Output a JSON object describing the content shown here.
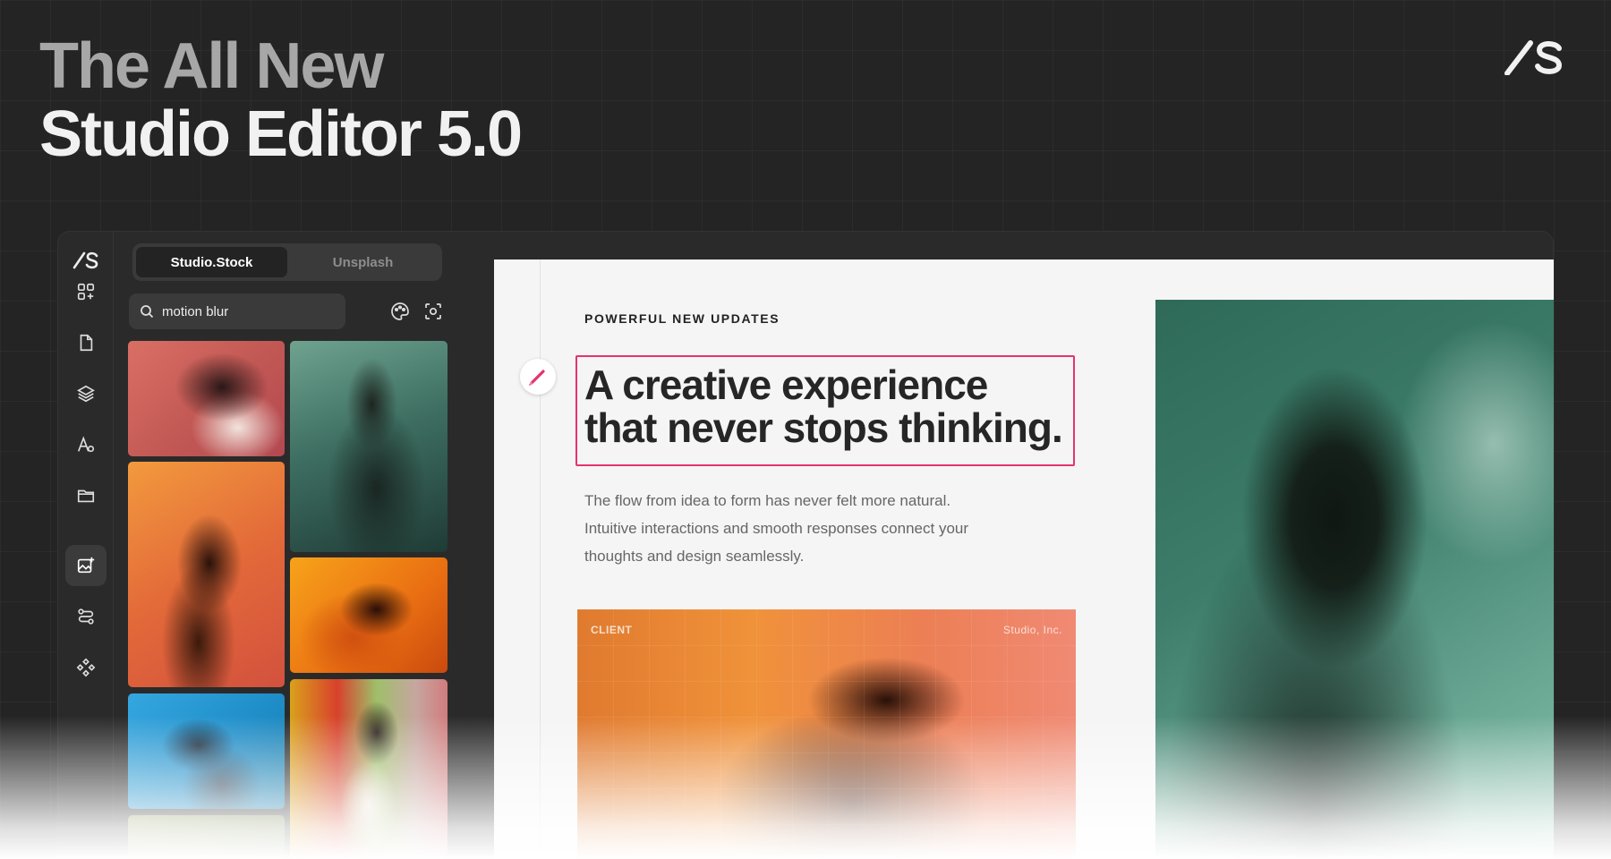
{
  "hero": {
    "line1": "The All New",
    "line2": "Studio Editor 5.0"
  },
  "brand": {
    "logo_text": "/S",
    "logo_icon": "slash-s-logo"
  },
  "rail": {
    "items": [
      {
        "name": "apps-grid-icon"
      },
      {
        "name": "page-icon"
      },
      {
        "name": "layers-icon"
      },
      {
        "name": "typography-icon"
      },
      {
        "name": "folder-icon"
      },
      {
        "name": "add-image-icon",
        "active": true
      },
      {
        "name": "flow-icon"
      },
      {
        "name": "components-icon"
      }
    ]
  },
  "panel": {
    "tabs": [
      {
        "label": "Studio.Stock",
        "active": true
      },
      {
        "label": "Unsplash",
        "active": false
      }
    ],
    "search": {
      "value": "motion blur",
      "placeholder": "Search"
    },
    "tools": [
      "palette-icon",
      "visual-search-icon"
    ],
    "results": [
      {
        "name": "blur-woman-pink"
      },
      {
        "name": "blur-figure-green"
      },
      {
        "name": "blur-runner-orange"
      },
      {
        "name": "blur-woman-amber"
      },
      {
        "name": "blur-man-blue"
      },
      {
        "name": "blur-woman-rainbow"
      },
      {
        "name": "blur-figure-olive"
      }
    ]
  },
  "canvas": {
    "eyebrow": "POWERFUL NEW UPDATES",
    "headline": "A creative experience that never stops thinking.",
    "body": "The flow from idea to form has never felt more natural. Intuitive interactions and smooth responses connect your thoughts and design seamlessly.",
    "card": {
      "client_label": "CLIENT",
      "client_name": "Studio, Inc."
    }
  },
  "colors": {
    "background": "#242424",
    "accent": "#e4336f",
    "artboard": "#f5f5f5"
  }
}
